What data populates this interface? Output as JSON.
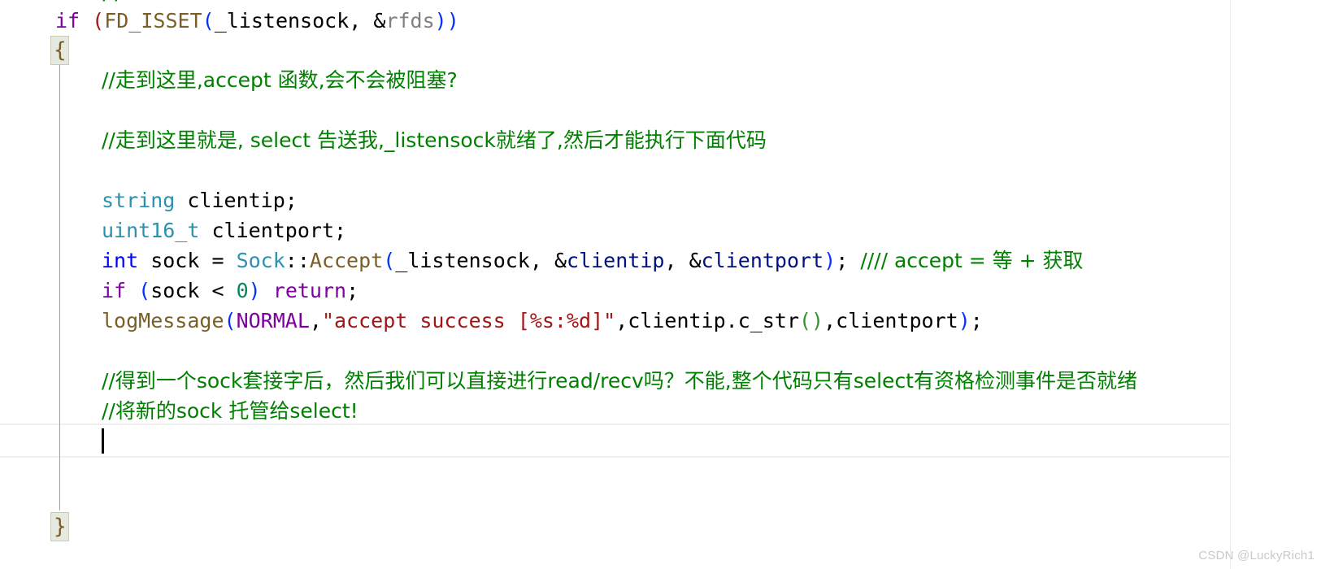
{
  "editor": {
    "language": "cpp",
    "theme": "light",
    "colors": {
      "background": "#ffffff",
      "keyword": "#7f00a0",
      "keyword_blue": "#0000ff",
      "type": "#2b91af",
      "function": "#795e26",
      "variable": "#001080",
      "comment": "#008000",
      "string": "#a31515",
      "number": "#098658",
      "paren_blue": "#0431fa",
      "paren_red": "#a31515",
      "paren_green": "#319331",
      "gray_token": "#808080",
      "current_line_border": "#f0f0f0",
      "brace_match_bg": "#e6e9df",
      "indent_guide": "#a0a0a0",
      "caret": "#000000",
      "watermark": "#c9c9c9"
    },
    "caret": {
      "visible": true,
      "column_indent": "4"
    }
  },
  "lines": {
    "l01": {
      "segments_note": "clipped partial line at very top of viewport"
    },
    "l02_if": {
      "kw_if": "if",
      "paren_open": " (",
      "fn": "FD_ISSET",
      "paren2": "(",
      "arg1": "_listensock",
      "comma": ", ",
      "amp": "&",
      "arg2": "rfds",
      "paren_close": "))"
    },
    "l03_brace_open": "{",
    "l04_comment": "//走到这里,accept 函数,会不会被阻塞?",
    "l05_comment": "//走到这里就是, select 告送我,_listensock就绪了,然后才能执行下面代码",
    "l06_string_decl": {
      "type": "string",
      "space": " ",
      "name": "clientip",
      "semi": ";"
    },
    "l07_uint_decl": {
      "type": "uint16_t",
      "space": " ",
      "name": "clientport",
      "semi": ";"
    },
    "l08_accept": {
      "kw_int": "int",
      "var_sock": " sock ",
      "eq": "= ",
      "cls": "Sock",
      "scope": "::",
      "fn": "Accept",
      "p1": "(",
      "a1": "_listensock",
      "c1": ", ",
      "amp1": "&",
      "a2": "clientip",
      "c2": ", ",
      "amp2": "&",
      "a3": "clientport",
      "p2": ")",
      "semi": "; ",
      "comment": "//// accept = 等 + 获取"
    },
    "l09_guard": {
      "kw_if": "if",
      "p1": " (",
      "var": "sock",
      "op": " < ",
      "num": "0",
      "p2": ") ",
      "kw_return": "return",
      "semi": ";"
    },
    "l10_log": {
      "fn": "logMessage",
      "p1": "(",
      "macro": "NORMAL",
      "c1": ",",
      "str": "\"accept success [%s:%d]\"",
      "c2": ",",
      "v1": "clientip",
      "dot": ".",
      "m1": "c_str",
      "p2": "()",
      "c3": ",",
      "v2": "clientport",
      "p3": ")",
      "semi": ";"
    },
    "l11_comment": "//得到一个sock套接字后，然后我们可以直接进行read/recv吗？不能,整个代码只有select有资格检测事件是否就绪",
    "l12_comment": "//将新的sock 托管给select!",
    "l13_empty": "",
    "l14_brace_close": "}"
  },
  "watermark": {
    "text": "CSDN @LuckyRich1"
  }
}
